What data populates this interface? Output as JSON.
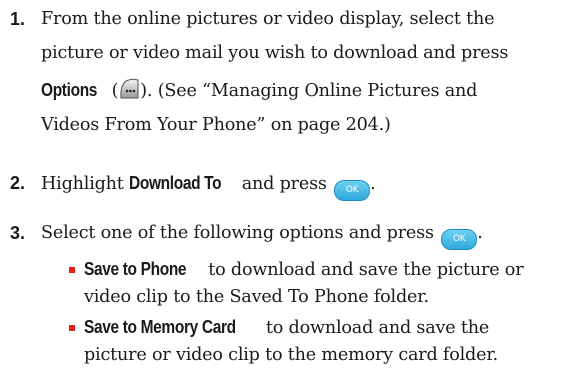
{
  "steps": [
    {
      "number": "1.",
      "line1": "From the online pictures or video display, select the",
      "line2": "picture or video mail you wish to download and press",
      "options_label": "Options",
      "options_paren_open": " (",
      "options_paren_close": ").",
      "line3_rest": " (See “Managing Online Pictures and",
      "line4": "Videos From Your Phone” on page 204.)",
      "options_icon": "softkey-icon"
    },
    {
      "number": "2.",
      "text_before": "Highlight ",
      "bold": "Download To",
      "text_after": " and press ",
      "button_label": "OK",
      "end": "."
    },
    {
      "number": "3.",
      "text": "Select one of the following options and press ",
      "button_label": "OK",
      "end": "."
    }
  ],
  "options": [
    {
      "bold": "Save to Phone",
      "line1_rest": " to download and save the picture or",
      "line2": "video clip to the Saved To Phone folder."
    },
    {
      "bold": "Save to Memory Card",
      "line1_rest": " to download and save the",
      "line2": "picture or video clip to the memory card folder."
    }
  ],
  "colors": {
    "bullet": "#e2231a",
    "ok_button": "#2fa8dc"
  }
}
